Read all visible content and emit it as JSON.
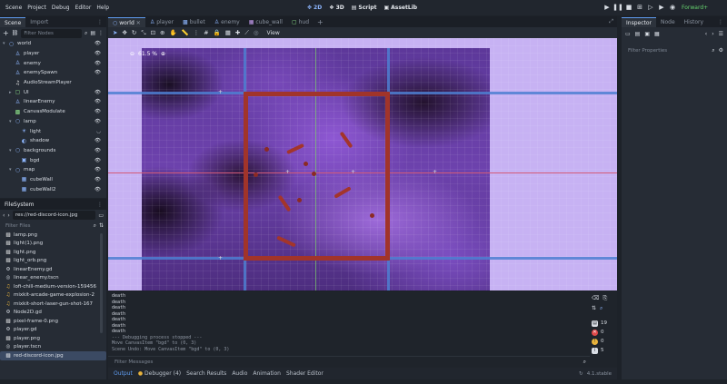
{
  "menu": [
    "Scene",
    "Project",
    "Debug",
    "Editor",
    "Help"
  ],
  "workspaces": {
    "w2d": "2D",
    "w3d": "3D",
    "script": "Script",
    "assetlib": "AssetLib"
  },
  "renderer": "Forward+",
  "scene_dock": {
    "tabs": [
      "Scene",
      "Import"
    ],
    "filter_placeholder": "Filter Nodes",
    "nodes": [
      {
        "label": "world",
        "icon": "node2d-icon",
        "color": "#8eb7ff"
      },
      {
        "label": "player",
        "icon": "character-icon",
        "color": "#8eb7ff"
      },
      {
        "label": "enemy",
        "icon": "character-icon",
        "color": "#8eb7ff"
      },
      {
        "label": "enemySpawn",
        "icon": "character-icon",
        "color": "#8eb7ff"
      },
      {
        "label": "AudioStreamPlayer",
        "icon": "audio-icon",
        "color": "#e0e0e0"
      },
      {
        "label": "UI",
        "icon": "control-icon",
        "color": "#8ee48a"
      },
      {
        "label": "linearEnemy",
        "icon": "character-icon",
        "color": "#8eb7ff"
      },
      {
        "label": "CanvasModulate",
        "icon": "canvas-modulate-icon",
        "color": "#8ee48a"
      },
      {
        "label": "lamp",
        "icon": "node2d-icon",
        "color": "#8eb7ff"
      },
      {
        "label": "light",
        "icon": "light-icon",
        "color": "#8eb7ff"
      },
      {
        "label": "shadow",
        "icon": "shadow-icon",
        "color": "#8eb7ff"
      },
      {
        "label": "backgrounds",
        "icon": "node2d-icon",
        "color": "#8eb7ff"
      },
      {
        "label": "bgd",
        "icon": "sprite-icon",
        "color": "#8eb7ff"
      },
      {
        "label": "map",
        "icon": "node2d-icon",
        "color": "#8eb7ff"
      },
      {
        "label": "cubeWall",
        "icon": "body-icon",
        "color": "#8eb7ff"
      },
      {
        "label": "cubeWall2",
        "icon": "body-icon",
        "color": "#8eb7ff"
      }
    ]
  },
  "filesystem": {
    "title": "FileSystem",
    "path": "res://red-discord-icon.jpg",
    "filter_placeholder": "Filter Files",
    "files": [
      {
        "label": "lamp.png",
        "icon": "image-icon"
      },
      {
        "label": "light(1).png",
        "icon": "image-icon"
      },
      {
        "label": "light.png",
        "icon": "image-icon"
      },
      {
        "label": "light_orb.png",
        "icon": "image-icon"
      },
      {
        "label": "linearEnemy.gd",
        "icon": "script-icon"
      },
      {
        "label": "linear_enemy.tscn",
        "icon": "scene-icon"
      },
      {
        "label": "lofi-chill-medium-version-159456",
        "icon": "audio-icon"
      },
      {
        "label": "mixkit-arcade-game-explosion-2",
        "icon": "audio-icon"
      },
      {
        "label": "mixkit-short-laser-gun-shot-167",
        "icon": "audio-icon"
      },
      {
        "label": "Node2D.gd",
        "icon": "script-icon"
      },
      {
        "label": "pixel-frame-0.png",
        "icon": "image-icon"
      },
      {
        "label": "player.gd",
        "icon": "script-icon"
      },
      {
        "label": "player.png",
        "icon": "image-icon"
      },
      {
        "label": "player.tscn",
        "icon": "scene-icon"
      },
      {
        "label": "red-discord-icon.jpg",
        "icon": "image-icon"
      }
    ]
  },
  "editor_tabs": [
    "world",
    "player",
    "bullet",
    "enemy",
    "cube_wall",
    "hud"
  ],
  "toolbar": {
    "view": "View"
  },
  "zoom": "61.5 %",
  "output": {
    "lines": [
      "death",
      "death",
      "death",
      "death",
      "death",
      "death",
      "death",
      "--- Debugging process stopped ---",
      "Move CanvasItem \"bgd\" to (0, 3)",
      "Scene Undo: Move CanvasItem \"bgd\" to (0, 3)"
    ],
    "filter_placeholder": "Filter Messages",
    "counters": {
      "log": "19",
      "errors": "0",
      "warnings": "0",
      "info": "5"
    }
  },
  "bottom_tabs": [
    "Output",
    "Debugger (4)",
    "Search Results",
    "Audio",
    "Animation",
    "Shader Editor"
  ],
  "version": "4.1.stable",
  "inspector": {
    "tabs": [
      "Inspector",
      "Node",
      "History"
    ],
    "filter_placeholder": "Filter Properties"
  }
}
